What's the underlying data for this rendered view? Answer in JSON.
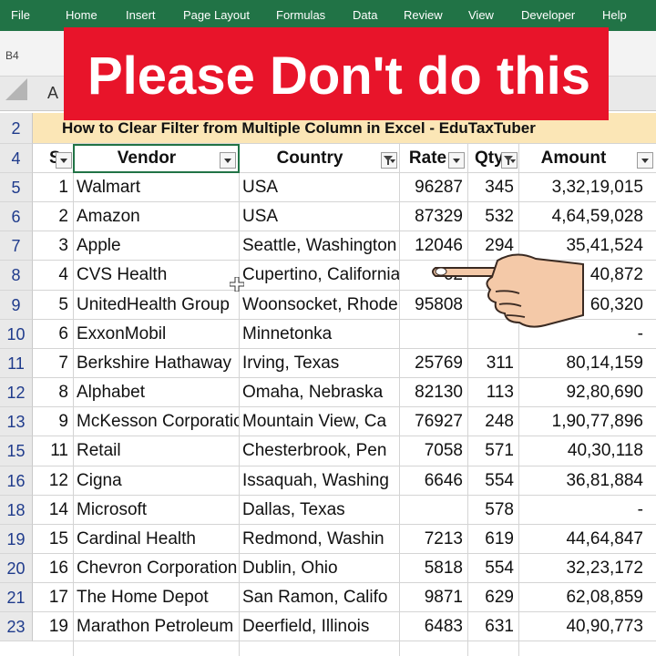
{
  "ribbon": {
    "tabs": [
      "File",
      "Home",
      "Insert",
      "Page Layout",
      "Formulas",
      "Data",
      "Review",
      "View",
      "Developer",
      "Help"
    ]
  },
  "name_box": "B4",
  "column_header_visible": "A",
  "banner": {
    "text": "Please Don't  do this"
  },
  "sheet": {
    "title": "How to Clear Filter from Multiple Column in Excel  - EduTaxTuber",
    "title_row_number": "2",
    "header_row_number": "4",
    "headers": {
      "sn": "S",
      "vendor": "Vendor",
      "country": "Country",
      "rate": "Rate",
      "qty": "Qty",
      "amount": "Amount"
    },
    "rows": [
      {
        "row": "5",
        "sn": "1",
        "vendor": "Walmart",
        "country": "USA",
        "rate": "96287",
        "qty": "345",
        "amount": "3,32,19,015"
      },
      {
        "row": "6",
        "sn": "2",
        "vendor": "Amazon",
        "country": "USA",
        "rate": "87329",
        "qty": "532",
        "amount": "4,64,59,028"
      },
      {
        "row": "7",
        "sn": "3",
        "vendor": "Apple",
        "country": "Seattle, Washington",
        "rate": "12046",
        "qty": "294",
        "amount": "35,41,524"
      },
      {
        "row": "8",
        "sn": "4",
        "vendor": "CVS Health",
        "country": "Cupertino, California",
        "rate": "62",
        "qty": "",
        "amount": "40,872"
      },
      {
        "row": "9",
        "sn": "5",
        "vendor": "UnitedHealth Group",
        "country": "Woonsocket, Rhode",
        "rate": "95808",
        "qty": "",
        "amount": "60,320"
      },
      {
        "row": "10",
        "sn": "6",
        "vendor": "ExxonMobil",
        "country": "Minnetonka",
        "rate": "",
        "qty": "",
        "amount": "-"
      },
      {
        "row": "11",
        "sn": "7",
        "vendor": "Berkshire Hathaway",
        "country": "Irving, Texas",
        "rate": "25769",
        "qty": "311",
        "amount": "80,14,159"
      },
      {
        "row": "12",
        "sn": "8",
        "vendor": "Alphabet",
        "country": "Omaha, Nebraska",
        "rate": "82130",
        "qty": "113",
        "amount": "92,80,690"
      },
      {
        "row": "13",
        "sn": "9",
        "vendor": "McKesson Corporation",
        "country": "Mountain View, Ca",
        "rate": "76927",
        "qty": "248",
        "amount": "1,90,77,896"
      },
      {
        "row": "15",
        "sn": "11",
        "vendor": "Retail",
        "country": "Chesterbrook, Pen",
        "rate": "7058",
        "qty": "571",
        "amount": "40,30,118"
      },
      {
        "row": "16",
        "sn": "12",
        "vendor": "Cigna",
        "country": "Issaquah, Washing",
        "rate": "6646",
        "qty": "554",
        "amount": "36,81,884"
      },
      {
        "row": "18",
        "sn": "14",
        "vendor": "Microsoft",
        "country": "Dallas, Texas",
        "rate": "",
        "qty": "578",
        "amount": "-"
      },
      {
        "row": "19",
        "sn": "15",
        "vendor": "Cardinal Health",
        "country": "Redmond, Washin",
        "rate": "7213",
        "qty": "619",
        "amount": "44,64,847"
      },
      {
        "row": "20",
        "sn": "16",
        "vendor": "Chevron Corporation",
        "country": "Dublin, Ohio",
        "rate": "5818",
        "qty": "554",
        "amount": "32,23,172"
      },
      {
        "row": "21",
        "sn": "17",
        "vendor": "The Home Depot",
        "country": "San Ramon, Califo",
        "rate": "9871",
        "qty": "629",
        "amount": "62,08,859"
      },
      {
        "row": "23",
        "sn": "19",
        "vendor": "Marathon Petroleum",
        "country": "Deerfield, Illinois",
        "rate": "6483",
        "qty": "631",
        "amount": "40,90,773"
      }
    ]
  },
  "colors": {
    "ribbon": "#217346",
    "banner": "#e8142a",
    "title_fill": "#fbe6b6",
    "row_number": "#1f3b8c"
  },
  "icons": {
    "filter_dropdown": "chevron-down-icon",
    "filter_active": "funnel-icon",
    "pointer": "pointing-hand-icon",
    "cursor": "crosshair-icon"
  }
}
